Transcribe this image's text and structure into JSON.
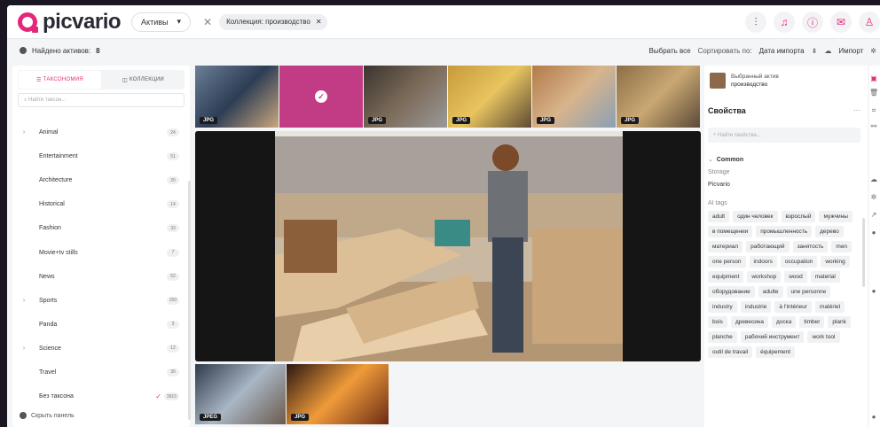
{
  "header": {
    "brand": "picvario",
    "assets_menu": "Активы",
    "filter_chip": "Коллекция: производство",
    "filter_close": "✕",
    "clear_close": "✕",
    "icons": [
      "sliders-icon",
      "bell-icon",
      "info-icon",
      "inbox-icon",
      "user-icon"
    ]
  },
  "toolbar": {
    "found_label": "Найдено активов:",
    "found_count": "8",
    "select_all": "Выбрать все",
    "sort_label": "Сортировать по:",
    "sort_value": "Дата импорта",
    "import_label": "Импорт"
  },
  "left": {
    "tab_taxonomy": "ТАКСОНОМИЯ",
    "tab_collections": "КОЛЛЕКЦИИ",
    "search_placeholder": "Найти таксон...",
    "hide_panel": "Скрыть панель",
    "items": [
      {
        "name": "Animal",
        "count": "24",
        "expandable": true
      },
      {
        "name": "Entertainment",
        "count": "51",
        "expandable": false
      },
      {
        "name": "Architecture",
        "count": "20",
        "expandable": false
      },
      {
        "name": "Historical",
        "count": "14",
        "expandable": false
      },
      {
        "name": "Fashion",
        "count": "33",
        "expandable": false
      },
      {
        "name": "Movie+tv stills",
        "count": "7",
        "expandable": false
      },
      {
        "name": "News",
        "count": "52",
        "expandable": false
      },
      {
        "name": "Sports",
        "count": "150",
        "expandable": true
      },
      {
        "name": "Panda",
        "count": "3",
        "expandable": false
      },
      {
        "name": "Science",
        "count": "12",
        "expandable": true
      },
      {
        "name": "Travel",
        "count": "30",
        "expandable": false
      },
      {
        "name": "Без таксона",
        "count": "3915",
        "expandable": false,
        "checked": true
      }
    ]
  },
  "gallery": {
    "thumbs": [
      {
        "badge": "JPG",
        "selected": false,
        "colors": [
          "#6b7f95",
          "#2d3d55",
          "#c9a77e"
        ]
      },
      {
        "badge": "",
        "selected": true,
        "colors": [
          "#c23b85",
          "#c23b85",
          "#c23b85"
        ]
      },
      {
        "badge": "JPG",
        "selected": false,
        "colors": [
          "#3a3530",
          "#7b6a58",
          "#9a9a9a"
        ]
      },
      {
        "badge": "JPG",
        "selected": false,
        "colors": [
          "#c89a3a",
          "#e7c45f",
          "#5d4a35"
        ]
      },
      {
        "badge": "JPG",
        "selected": false,
        "colors": [
          "#b37a48",
          "#d8b48c",
          "#8aa0b4"
        ]
      },
      {
        "badge": "JPG",
        "selected": false,
        "colors": [
          "#8c6e45",
          "#c9a873",
          "#5b4a38"
        ]
      }
    ],
    "bottom_thumbs": [
      {
        "badge": "JPEG",
        "colors": [
          "#2f3a4a",
          "#a9b6c5",
          "#6b5a4c"
        ]
      },
      {
        "badge": "JPG",
        "colors": [
          "#2a1710",
          "#f09b3a",
          "#6b2b14"
        ]
      }
    ]
  },
  "right": {
    "selected_label": "Выбранный актив",
    "selected_name": "производство",
    "properties_title": "Свойства",
    "more": "···",
    "search_placeholder": "Найти свойства...",
    "section": "Common",
    "storage_label": "Storage",
    "storage_value": "Picvario",
    "ai_tags_label": "AI tags",
    "tags": [
      "adult",
      "один человек",
      "взрослый",
      "мужчины",
      "в помещении",
      "промышленность",
      "дерево",
      "материал",
      "работающий",
      "занятость",
      "men",
      "one person",
      "indoors",
      "occupation",
      "working",
      "equipment",
      "workshop",
      "wood",
      "material",
      "оборудование",
      "adulte",
      "une personne",
      "industry",
      "industrie",
      "à l'intérieur",
      "matériel",
      "bois",
      "древесина",
      "доска",
      "timber",
      "plank",
      "planche",
      "рабочий инструмент",
      "work tool",
      "outil de travail",
      "équipement"
    ]
  }
}
